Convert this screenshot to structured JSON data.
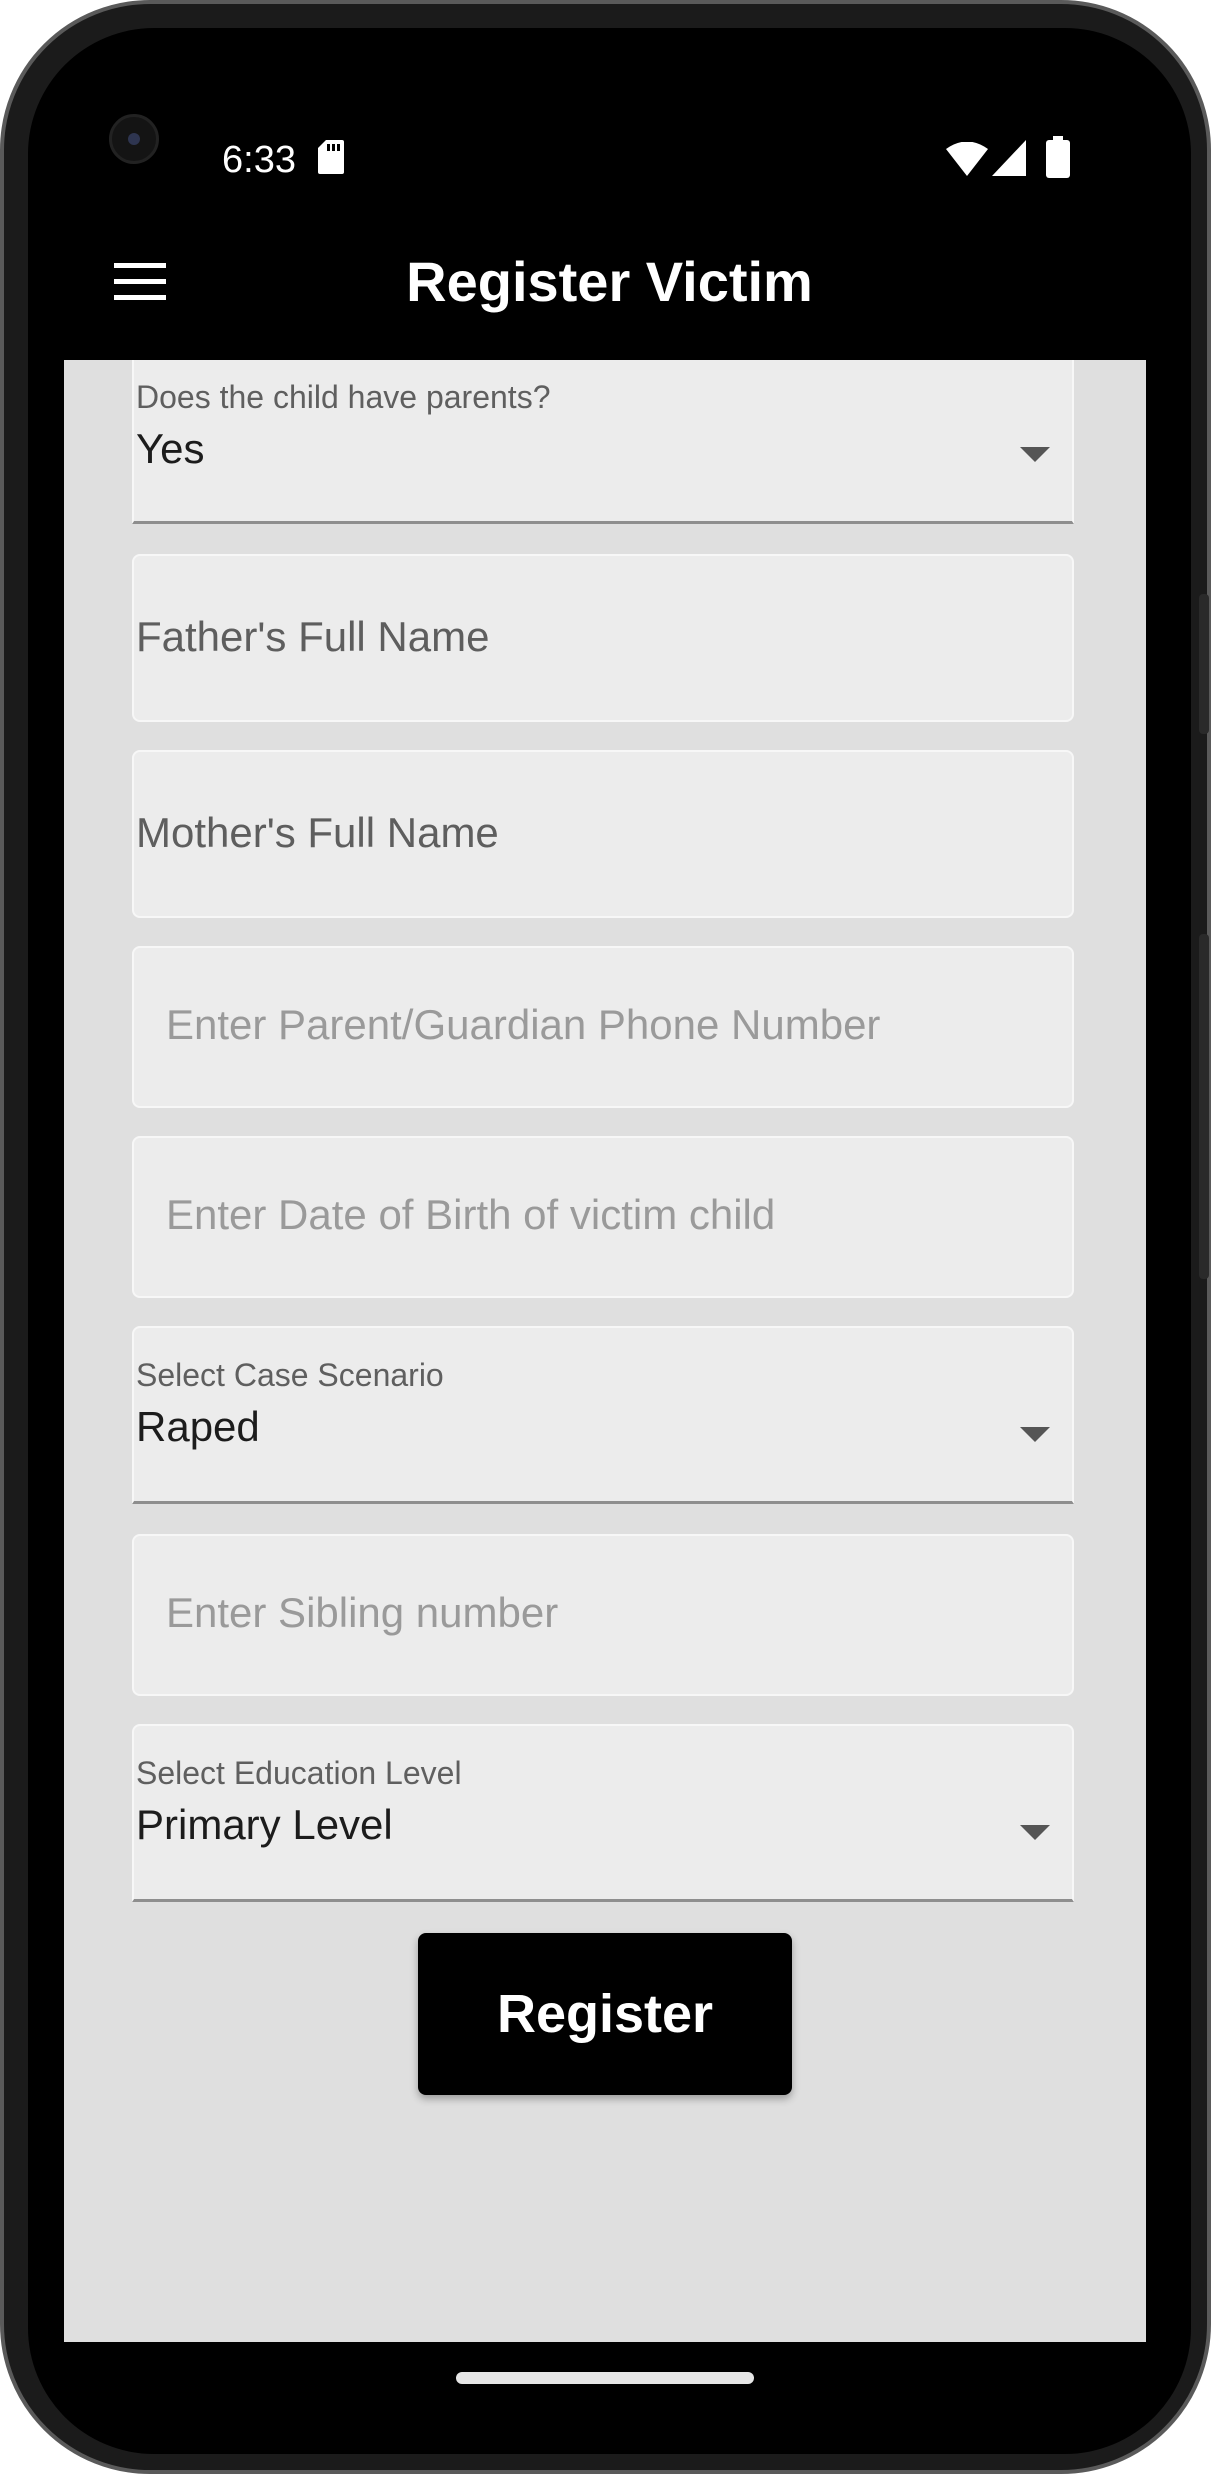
{
  "status_bar": {
    "time": "6:33",
    "icons": [
      "camera-icon",
      "sd-card-icon",
      "wifi-icon",
      "signal-icon",
      "battery-icon"
    ]
  },
  "app_bar": {
    "title": "Register Victim",
    "menu_icon": "hamburger-menu-icon",
    "background": "#000000"
  },
  "form": {
    "has_parents": {
      "label": "Does the child have parents?",
      "value": "Yes"
    },
    "father_name": {
      "placeholder": "Father's Full Name"
    },
    "mother_name": {
      "placeholder": "Mother's Full Name"
    },
    "guardian_phone": {
      "placeholder": "Enter Parent/Guardian Phone Number"
    },
    "date_of_birth": {
      "placeholder": "Enter Date of Birth of victim child"
    },
    "case_scenario": {
      "label": "Select Case Scenario",
      "value": "Raped"
    },
    "sibling_number": {
      "placeholder": "Enter Sibling number"
    },
    "education_level": {
      "label": "Select Education Level",
      "value": "Primary Level"
    },
    "register_label": "Register"
  },
  "colors": {
    "content_background": "#dfdfdf",
    "field_background": "#ececec",
    "button_background": "#000000",
    "button_text": "#ffffff"
  }
}
